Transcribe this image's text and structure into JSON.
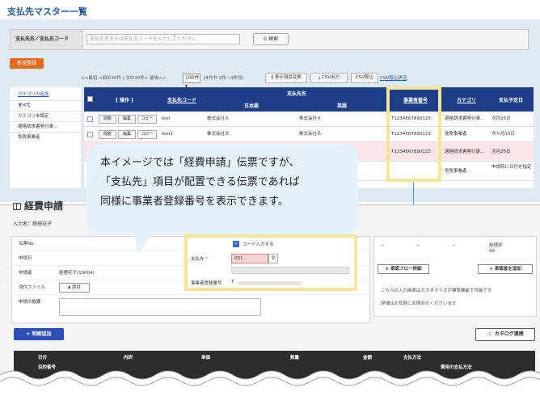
{
  "master": {
    "title": "支払先マスター一覧",
    "search_label": "支払先名／支払先コード",
    "search_placeholder": "支払先名または支払先コードを入力してください",
    "search_button": "検索",
    "new_button": "新規登録",
    "pager": "<<最初 <前の30件 | 次の30件> 最後>>",
    "per_page": "100件",
    "count": "(4件中 1件〜4件目)",
    "toolbar": {
      "display_change": "表示項目変更",
      "csv_export": "CSV出力",
      "csv_import": "CSV取込",
      "csv_status": "CSV取込状況"
    },
    "categories": {
      "add": "カテゴリの追加",
      "items": [
        "すべて",
        "カテゴリ未設定",
        "適格請求書発行事…",
        "免税事業者"
      ]
    },
    "table": {
      "headers": {
        "operation": "[ 操作 ]",
        "code": "支払先コード",
        "name": "支払先名",
        "name_ja": "日本語",
        "name_en": "英語",
        "reg_no": "事業者番号",
        "category": "カテゴリ",
        "pay_date": "支払予定日"
      },
      "row_buttons": [
        "閲覧",
        "編集",
        "コピー"
      ],
      "rows": [
        {
          "code": "test",
          "name_ja": "株式会社Ａ",
          "name_en": "株式会社Ａ",
          "reg_no": "T1234567890123",
          "category": "適格請求書発行事…",
          "pay_date": "次月25日"
        },
        {
          "code": "test2",
          "name_ja": "株式会社Ｂ",
          "name_en": "株式会社Ｂ",
          "reg_no": "T1234567890123",
          "category": "免税事業者",
          "pay_date": "次々月15日"
        },
        {
          "code": "",
          "name_ja": "",
          "name_en": "",
          "reg_no": "T1234567890123",
          "category": "適格請求書発行事…",
          "pay_date": "次月25日"
        },
        {
          "code": "",
          "name_ja": "",
          "name_en": "",
          "reg_no": "",
          "category": "免税事業者",
          "pay_date": "申請時に日付を指定"
        }
      ]
    }
  },
  "bubble": {
    "lines": [
      "本イメージでは「経費申請」伝票ですが、",
      "「支払先」項目が配置できる伝票であれば",
      "同様に事業者登録番号を表示できます。"
    ]
  },
  "expense": {
    "title": "経費申請",
    "inputter": "入力者：経理花子",
    "labels": {
      "slip_no": "伝票No.",
      "apply_date": "申請日",
      "applicant": "申請者",
      "attachment": "添付ファイル",
      "summary": "申請の概要"
    },
    "applicant_value": "経理花子(10004)",
    "attach_button": "添付",
    "vendor": {
      "code_input_label": "コード入力する",
      "payee_label": "支払先",
      "required_mark": "*",
      "code_value": "001",
      "reg_no_label": "事業者登録番号",
      "reg_no_prefix": "T"
    },
    "approval": {
      "dashes": [
        "−",
        "−",
        "−"
      ],
      "dept": "経理部",
      "dept_no": "99",
      "flow_button": "承認フロー詳細",
      "add_approver_button": "承認者を追加",
      "note1": "こちらの入力画面はカスタマイズが標準機能で可能です",
      "note2": "詳細はお気軽にお問合せくださいませ"
    },
    "add_line_button": "明細追加",
    "catalog_button": "カタログ連携",
    "detail_headers": [
      "日付",
      "内訳",
      "単価",
      "数量",
      "金額",
      "支払方法"
    ],
    "detail_headers_row2": [
      "目的番号",
      "費用の支払方法"
    ]
  },
  "colors": {
    "accent_orange": "#e8691b",
    "header_navy": "#1d3f88",
    "highlight_yellow": "#f5e49a",
    "bubble_blue": "#e6f1fb",
    "link_blue": "#1e50c8"
  }
}
